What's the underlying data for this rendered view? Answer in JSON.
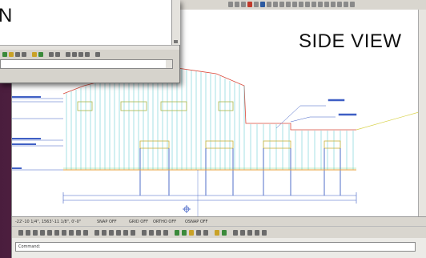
{
  "drawing": {
    "title": "SIDE VIEW"
  },
  "overlay": {
    "visible_heading_fragment": "N"
  },
  "status_bar": {
    "coords": "-22'-10 1/4\", 1563'-11 1/8\", 0'-0\"",
    "snap": "SNAP OFF",
    "grid": "GRID OFF",
    "ortho": "ORTHO OFF",
    "osnap": "OSNAP OFF"
  },
  "command_line": {
    "prompt": "Command:"
  },
  "colors": {
    "drawing_blue": "#3f5fc4",
    "drawing_cyan": "#4fc4c9",
    "drawing_orange": "#e8a13a",
    "drawing_red": "#d9483a",
    "drawing_green": "#5cc45c",
    "background_purple": "#6b3558"
  }
}
